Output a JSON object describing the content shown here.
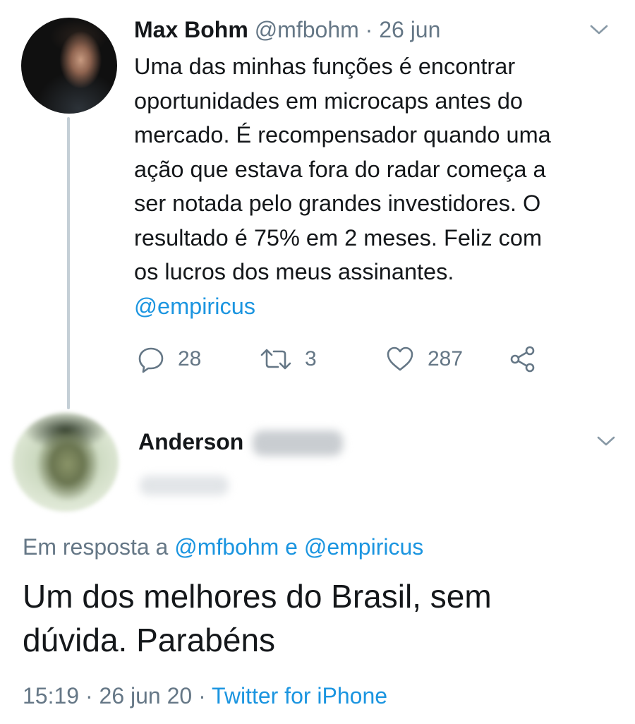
{
  "tweet1": {
    "name": "Max Bohm",
    "handle": "@mfbohm",
    "separator": "·",
    "date": "26 jun",
    "body_lines": [
      "Uma das minhas funções é encontrar",
      "oportunidades em microcaps antes do",
      "mercado. É recompensador quando uma",
      "ação que estava fora do radar começa a",
      "ser notada pelo grandes investidores. O",
      "resultado é 75% em 2 meses. Feliz com",
      "os lucros dos meus assinantes."
    ],
    "mention": "@empiricus",
    "replies": "28",
    "retweets": "3",
    "likes": "287"
  },
  "tweet2": {
    "name": "Anderson",
    "reply_prefix": "Em resposta a",
    "reply_mention1": "@mfbohm",
    "reply_conj": "e",
    "reply_mention2": "@empiricus",
    "body_lines": [
      "Um dos melhores do Brasil, sem",
      "dúvida. Parabéns"
    ],
    "time": "15:19",
    "separator": "·",
    "date": "26 jun 20",
    "source": "Twitter for iPhone"
  },
  "colors": {
    "link": "#1b95e0",
    "secondary_text": "#657786",
    "primary_text": "#14171a",
    "thread_line": "#c4cfd6"
  },
  "icons": [
    "chevron-down-icon",
    "reply-icon",
    "retweet-icon",
    "heart-icon",
    "share-icon"
  ]
}
